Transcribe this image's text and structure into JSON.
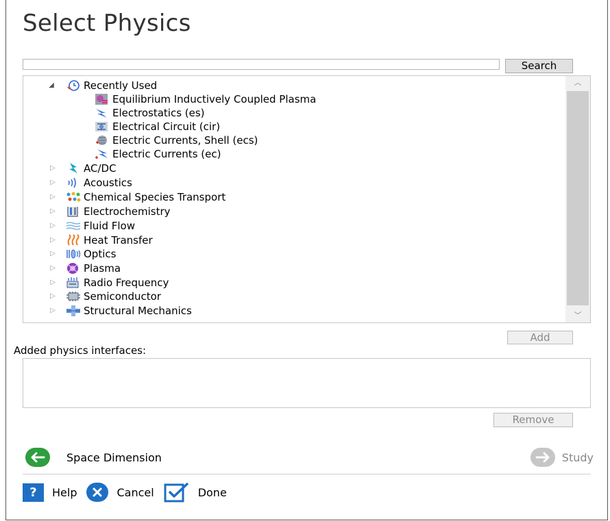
{
  "dialog": {
    "title": "Select Physics"
  },
  "search": {
    "value": "",
    "button_label": "Search"
  },
  "tree": {
    "recently_used": {
      "label": "Recently Used",
      "expanded": true,
      "items": [
        {
          "label": "Equilibrium Inductively Coupled Plasma",
          "icon": "plasma-coupling-icon"
        },
        {
          "label": "Electrostatics (es)",
          "icon": "electrostatics-icon"
        },
        {
          "label": "Electrical Circuit (cir)",
          "icon": "electrical-circuit-icon"
        },
        {
          "label": "Electric Currents, Shell (ecs)",
          "icon": "electric-currents-shell-icon"
        },
        {
          "label": "Electric Currents (ec)",
          "icon": "electric-currents-icon"
        }
      ]
    },
    "categories": [
      {
        "label": "AC/DC",
        "icon": "acdc-icon",
        "expanded": false
      },
      {
        "label": "Acoustics",
        "icon": "acoustics-icon",
        "expanded": false
      },
      {
        "label": "Chemical Species Transport",
        "icon": "chemical-species-icon",
        "expanded": false
      },
      {
        "label": "Electrochemistry",
        "icon": "electrochemistry-icon",
        "expanded": false
      },
      {
        "label": "Fluid Flow",
        "icon": "fluid-flow-icon",
        "expanded": false
      },
      {
        "label": "Heat Transfer",
        "icon": "heat-transfer-icon",
        "expanded": false
      },
      {
        "label": "Optics",
        "icon": "optics-icon",
        "expanded": false
      },
      {
        "label": "Plasma",
        "icon": "plasma-icon",
        "expanded": false
      },
      {
        "label": "Radio Frequency",
        "icon": "radio-frequency-icon",
        "expanded": false
      },
      {
        "label": "Semiconductor",
        "icon": "semiconductor-icon",
        "expanded": false
      },
      {
        "label": "Structural Mechanics",
        "icon": "structural-mechanics-icon",
        "expanded": false
      }
    ]
  },
  "buttons": {
    "add": "Add",
    "remove": "Remove"
  },
  "added_interfaces": {
    "label": "Added physics interfaces:",
    "items": []
  },
  "navigation": {
    "back_label": "Space Dimension",
    "next_label": "Study",
    "back_color": "#2e9e3e",
    "next_color": "#c6c6c6"
  },
  "footer": {
    "help": "Help",
    "cancel": "Cancel",
    "done": "Done"
  },
  "colors": {
    "accent_blue": "#1e6fc4",
    "scroll_thumb": "#cdcdcd"
  }
}
